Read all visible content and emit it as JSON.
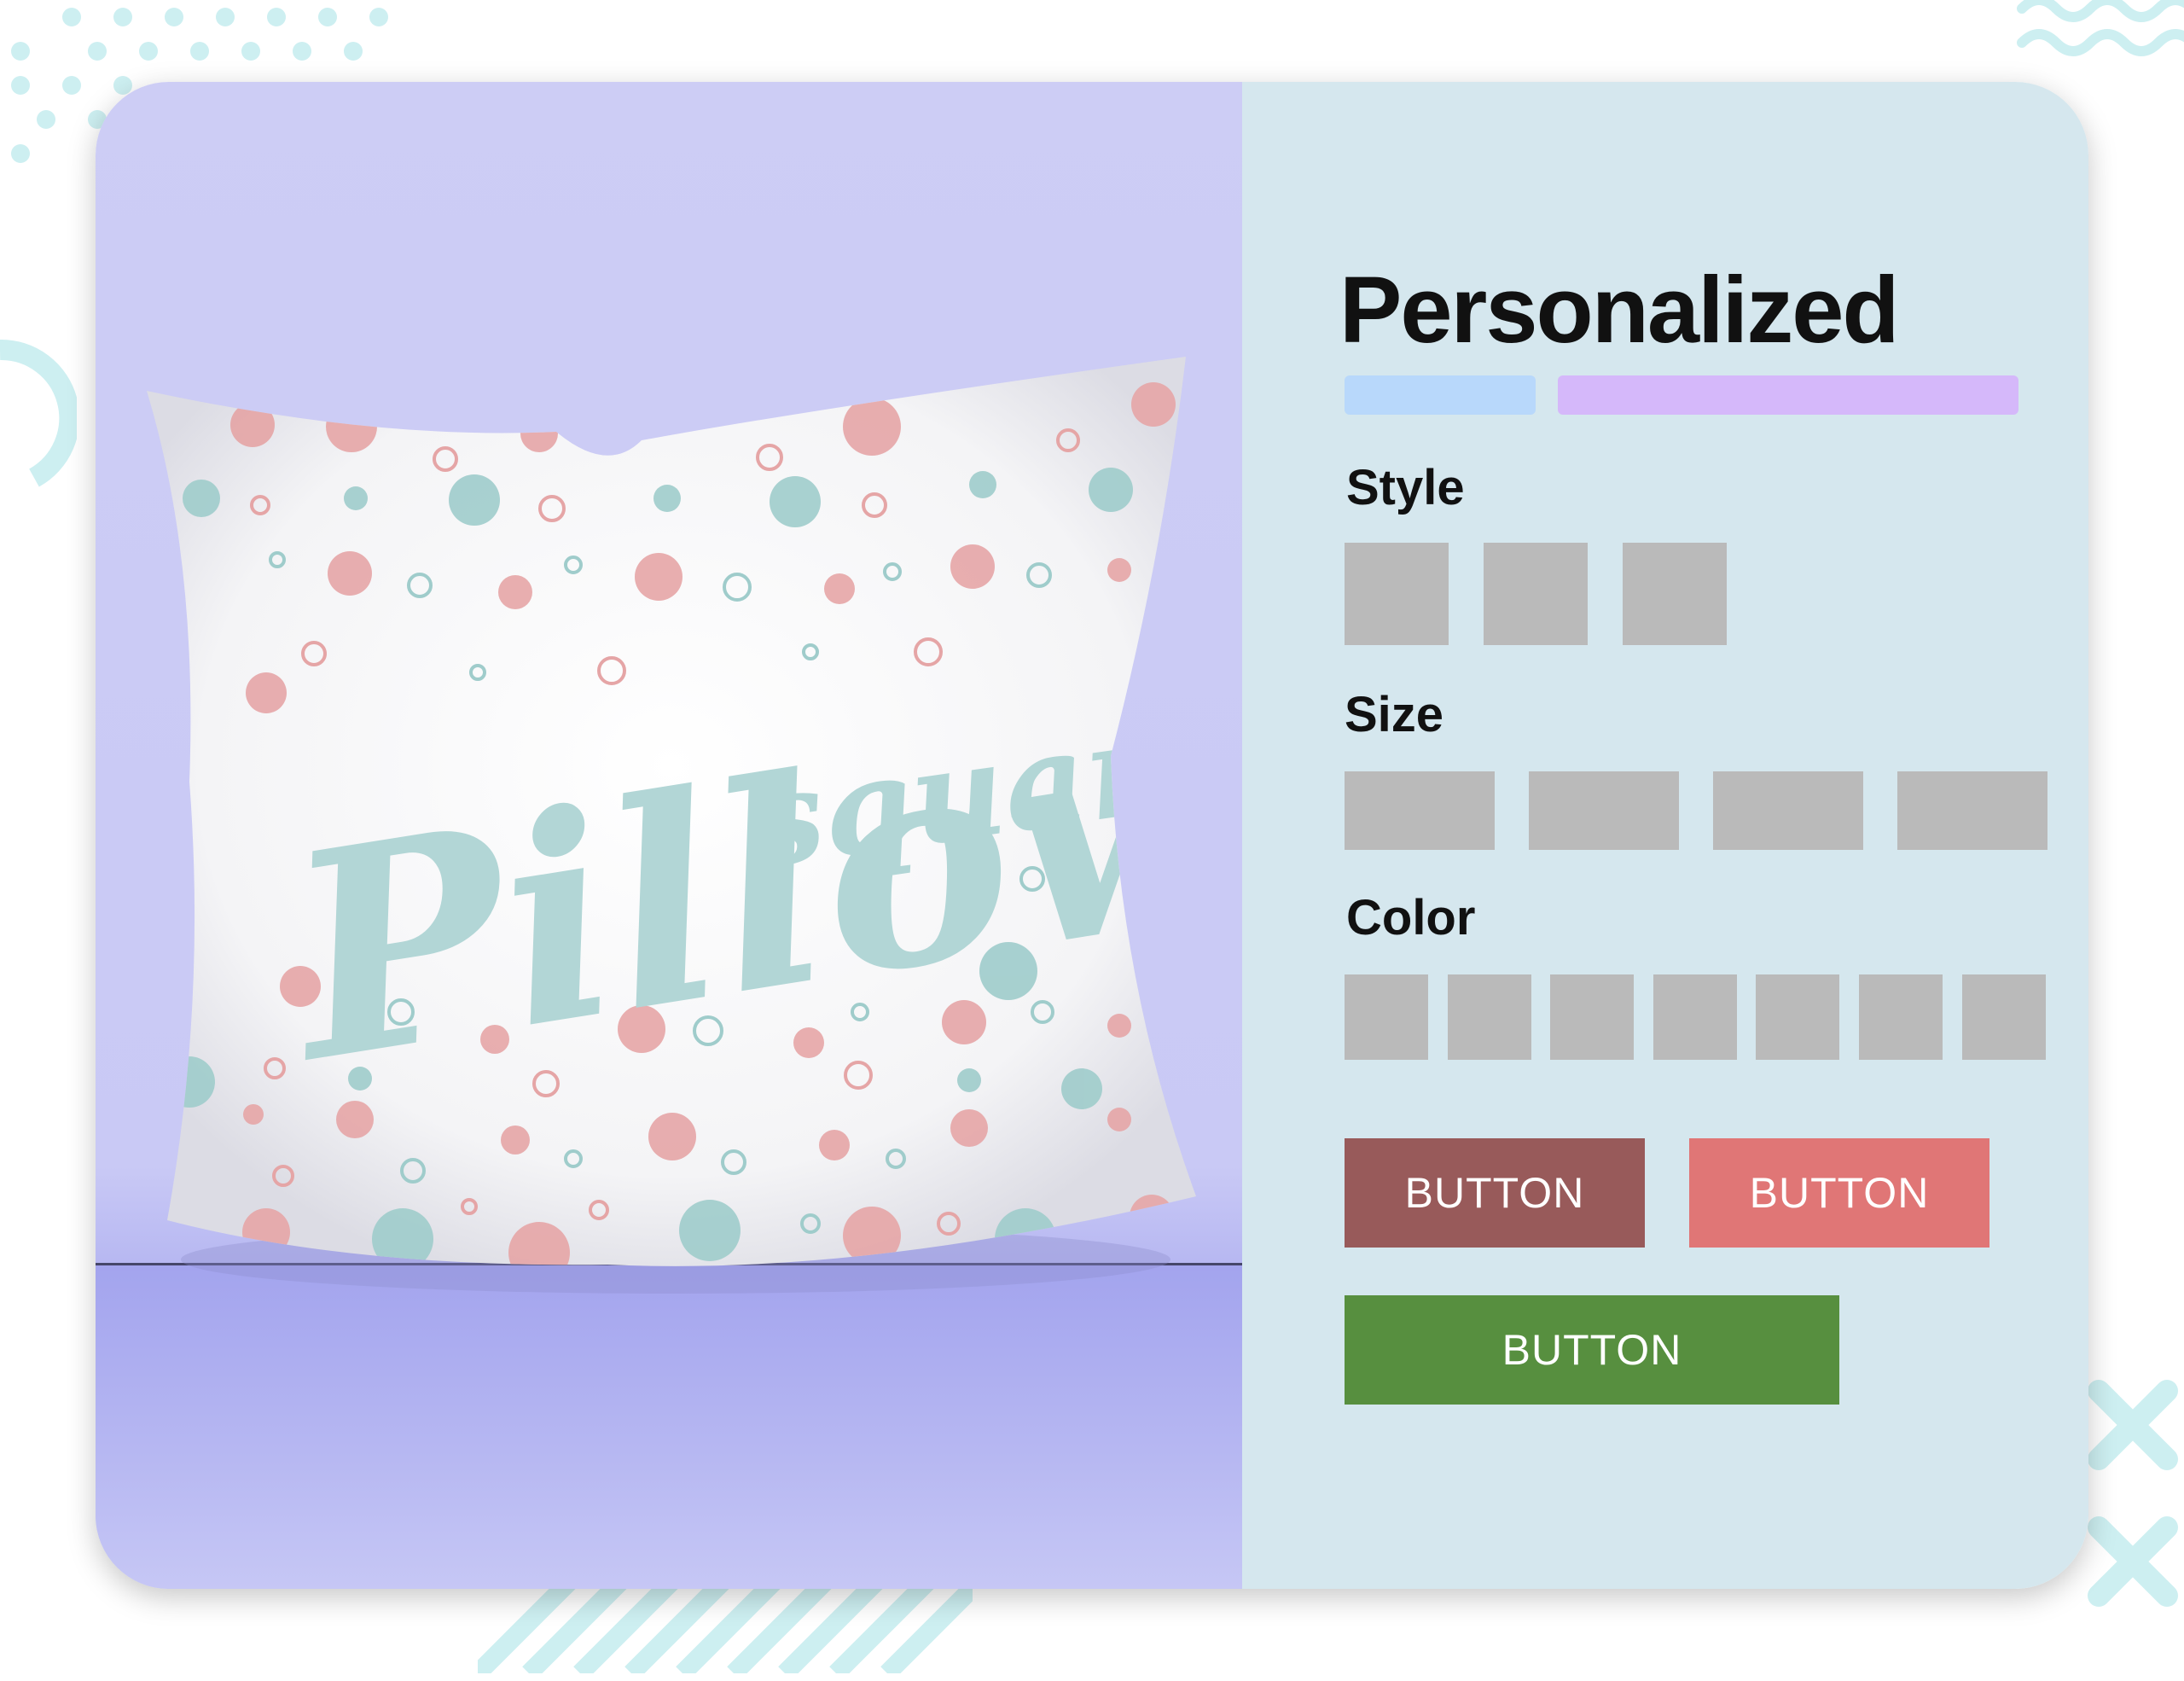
{
  "product": {
    "pillow_text_script": "Pillow",
    "pillow_text_small": "square",
    "image_name": "square pillow mockup"
  },
  "panel": {
    "title": "Personalized",
    "bar_colors": [
      "#b8d8fb",
      "#d5b8fa"
    ]
  },
  "options": {
    "style_label": "Style",
    "size_label": "Size",
    "color_label": "Color",
    "style_count": 3,
    "size_count": 4,
    "color_count": 7
  },
  "buttons": {
    "button_1_label": "BUTTON",
    "button_2_label": "BUTTON",
    "button_3_label": "BUTTON"
  },
  "colors": {
    "page_bg": "#ffffff",
    "left_panel": "#cdcdf5",
    "right_panel": "#d5e7ee",
    "swatch": "#bababa",
    "button_1": "#985a5a",
    "button_2": "#e07676",
    "button_3": "#578f3f",
    "decor": "#c9eef0"
  }
}
